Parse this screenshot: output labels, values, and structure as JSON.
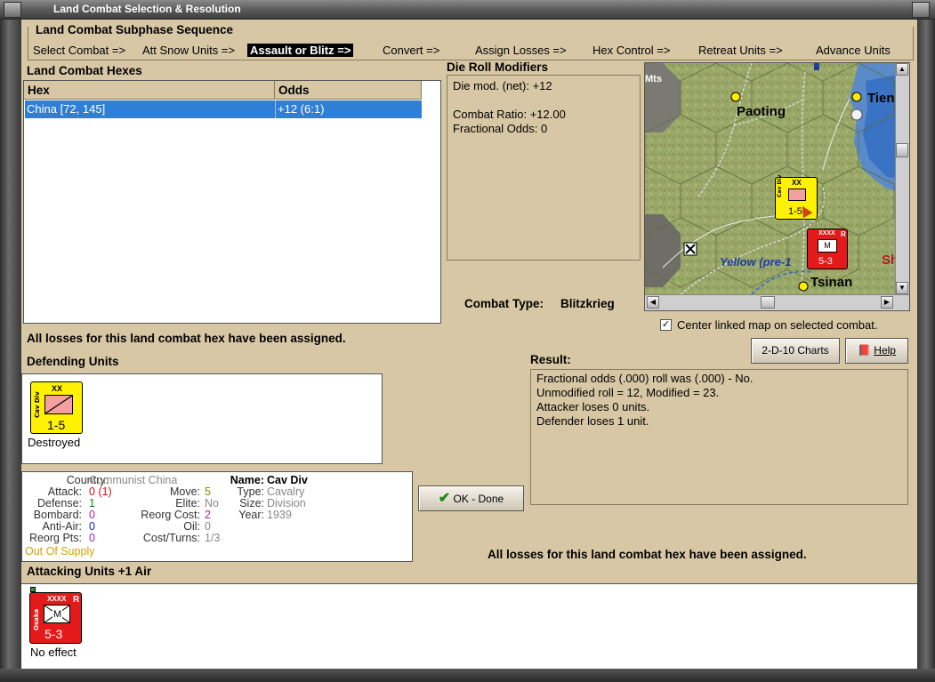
{
  "window": {
    "title": "Land Combat Selection & Resolution"
  },
  "subphase": {
    "title": "Land Combat Subphase Sequence",
    "phases": [
      "Select Combat =>",
      "Att Snow Units =>",
      "Assault or Blitz =>",
      "Convert =>",
      "Assign Losses =>",
      "Hex Control =>",
      "Retreat Units =>",
      "Advance Units"
    ],
    "current_index": 2
  },
  "hexes": {
    "title": "Land Combat Hexes",
    "columns": [
      "Hex",
      "Odds"
    ],
    "rows": [
      {
        "hex": "China [72, 145]",
        "odds": "+12 (6:1)"
      }
    ]
  },
  "die": {
    "title": "Die Roll Modifiers",
    "lines": [
      "Die mod. (net): +12",
      "",
      "Combat Ratio: +12.00",
      "Fractional Odds: 0"
    ]
  },
  "map": {
    "labels": {
      "mts": "Mts",
      "paoting": "Paoting",
      "tien": "Tien",
      "yellow": "Yellow (pre-1",
      "tsinan": "Tsinan",
      "sh": "Sh"
    },
    "cav_counter": {
      "size": "XX",
      "strength": "1-5",
      "side": "Cav Div"
    },
    "mech_counter": {
      "size": "XXXX",
      "strength": "5-3",
      "badge": "R",
      "letter": "M",
      "side": "Osaka"
    }
  },
  "combat_type": {
    "label": "Combat Type:",
    "value": "Blitzkrieg"
  },
  "center_map": {
    "checked": true,
    "label": "Center linked map on selected combat."
  },
  "losses_msg": "All losses for this land combat hex have been assigned.",
  "buttons": {
    "charts": "2-D-10 Charts",
    "help": "Help",
    "ok": "OK - Done"
  },
  "defending": {
    "title": "Defending Units",
    "unit": {
      "name": "Cav Div",
      "size": "XX",
      "strength": "1-5",
      "status": "Destroyed"
    }
  },
  "unit_info": {
    "country_label": "Country:",
    "country": "Communist China",
    "attack_label": "Attack:",
    "attack": "0",
    "attack_mod": "(1)",
    "defense_label": "Defense:",
    "defense": "1",
    "bombard_label": "Bombard:",
    "bombard": "0",
    "antiair_label": "Anti-Air:",
    "antiair": "0",
    "reorgpts_label": "Reorg Pts:",
    "reorgpts": "0",
    "supply": "Out Of Supply",
    "move_label": "Move:",
    "move": "5",
    "elite_label": "Elite:",
    "elite": "No",
    "reorgcost_label": "Reorg Cost:",
    "reorgcost": "2",
    "oil_label": "Oil:",
    "oil": "0",
    "costturns_label": "Cost/Turns:",
    "costturns": "1/3",
    "name_label": "Name:",
    "name": "Cav Div",
    "type_label": "Type:",
    "type": "Cavalry",
    "size_label": "Size:",
    "size": "Division",
    "year_label": "Year:",
    "year": "1939"
  },
  "result": {
    "title": "Result:",
    "lines": [
      "Fractional odds (.000) roll was (.000)  - No.",
      "Unmodified roll = 12, Modified = 23.",
      "Attacker loses 0 units.",
      "Defender loses 1 unit."
    ]
  },
  "attacking": {
    "title": "Attacking Units +1 Air",
    "unit": {
      "name": "Osaka",
      "size": "XXXX",
      "strength": "5-3",
      "badge": "R",
      "letter": "M",
      "status": "No effect"
    }
  },
  "colors": {
    "panel": "#d8c7a4",
    "selection": "#2f7fd6",
    "cavalry": "#fff200",
    "japan": "#e41a1a"
  }
}
